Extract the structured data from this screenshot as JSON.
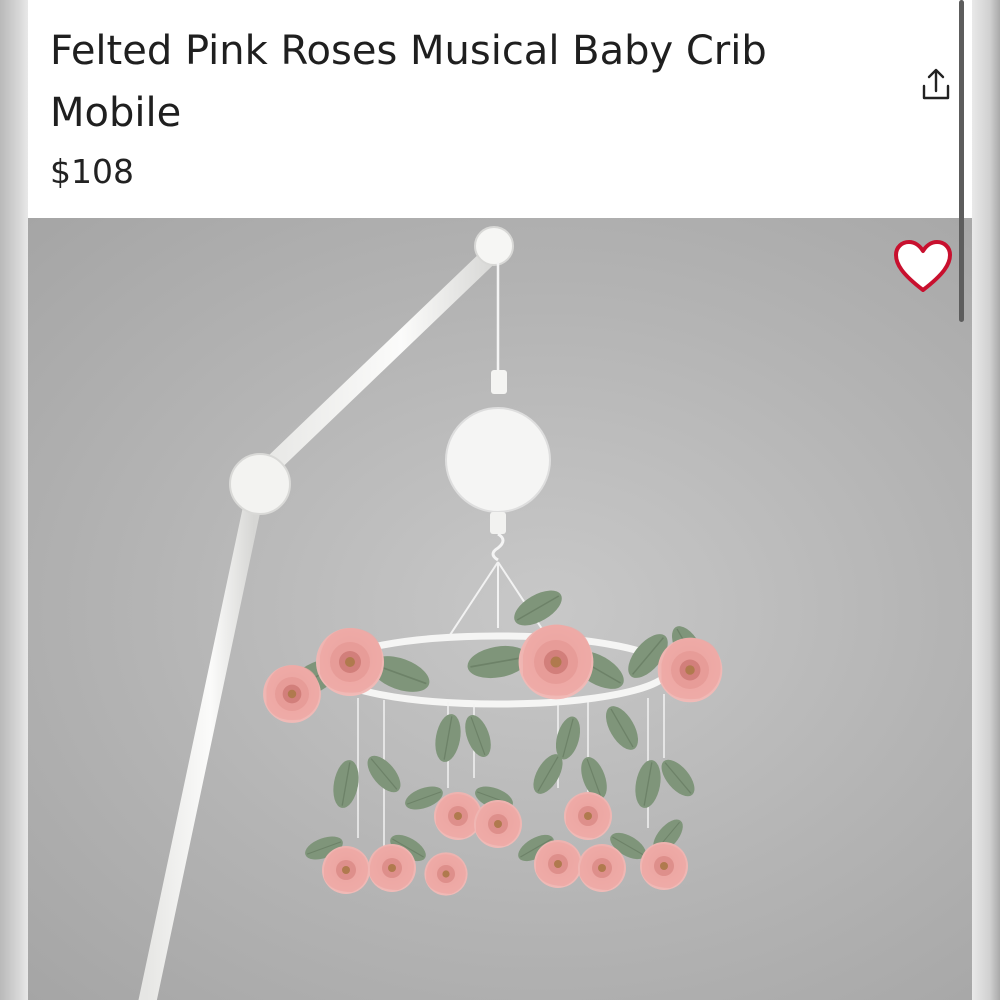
{
  "product": {
    "title": "Felted Pink Roses Musical Baby Crib Mobile",
    "price": "$108"
  },
  "icons": {
    "share": "share-icon",
    "favorite": "heart-icon"
  },
  "colors": {
    "heart_outline": "#c8102e",
    "rose_pink": "#e9a3a0",
    "leaf_green": "#7f957a",
    "backdrop_gray": "#b4b4b4"
  }
}
